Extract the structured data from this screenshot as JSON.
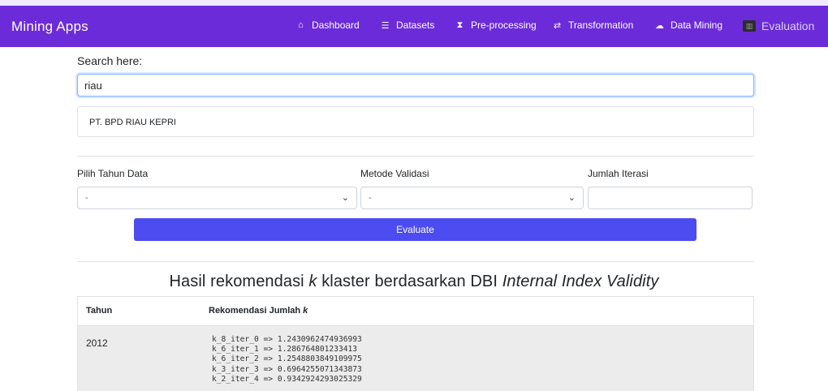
{
  "app": {
    "brand": "Mining Apps"
  },
  "nav": {
    "items": [
      {
        "label": "Dashboard",
        "icon": "home-icon",
        "glyph": "⌂",
        "active": false
      },
      {
        "label": "Datasets",
        "icon": "database-icon",
        "glyph": "☰",
        "active": false
      },
      {
        "label": "Pre-processing",
        "icon": "hourglass-icon",
        "glyph": "⧗",
        "active": false
      },
      {
        "label": "Transformation",
        "icon": "exchange-icon",
        "glyph": "⇄",
        "active": false
      },
      {
        "label": "Data Mining",
        "icon": "cloud-icon",
        "glyph": "☁",
        "active": false
      },
      {
        "label": "Evaluation",
        "icon": "chart-icon",
        "glyph": "▥",
        "active": true
      }
    ]
  },
  "search": {
    "label": "Search here:",
    "value": "riau",
    "results": [
      "PT. BPD RIAU KEPRI"
    ]
  },
  "form": {
    "year_label": "Pilih Tahun Data",
    "year_value": "-",
    "method_label": "Metode Validasi",
    "method_value": "-",
    "iter_label": "Jumlah Iterasi",
    "iter_value": "",
    "evaluate_label": "Evaluate"
  },
  "results": {
    "title_prefix": "Hasil rekomendasi",
    "title_k": "k",
    "title_middle": "klaster berdasarkan DBI",
    "title_italic": "Internal Index Validity",
    "columns": {
      "year": "Tahun",
      "recommendation": "Rekomendasi Jumlah",
      "recommendation_k": "k"
    },
    "rows": [
      {
        "year": "2012",
        "lines": [
          "k_8_iter_0 => 1.2430962474936993",
          "k_6_iter_1 => 1.286764801233413",
          "k_6_iter_2 => 1.2548803849109975",
          "k_3_iter_3 => 0.6964255071343873",
          "k_2_iter_4 => 0.9342924293025329"
        ]
      }
    ]
  },
  "colors": {
    "navbar": "#6c2bd9",
    "button": "#4c4cf0",
    "focus_border": "#86b7fe"
  }
}
